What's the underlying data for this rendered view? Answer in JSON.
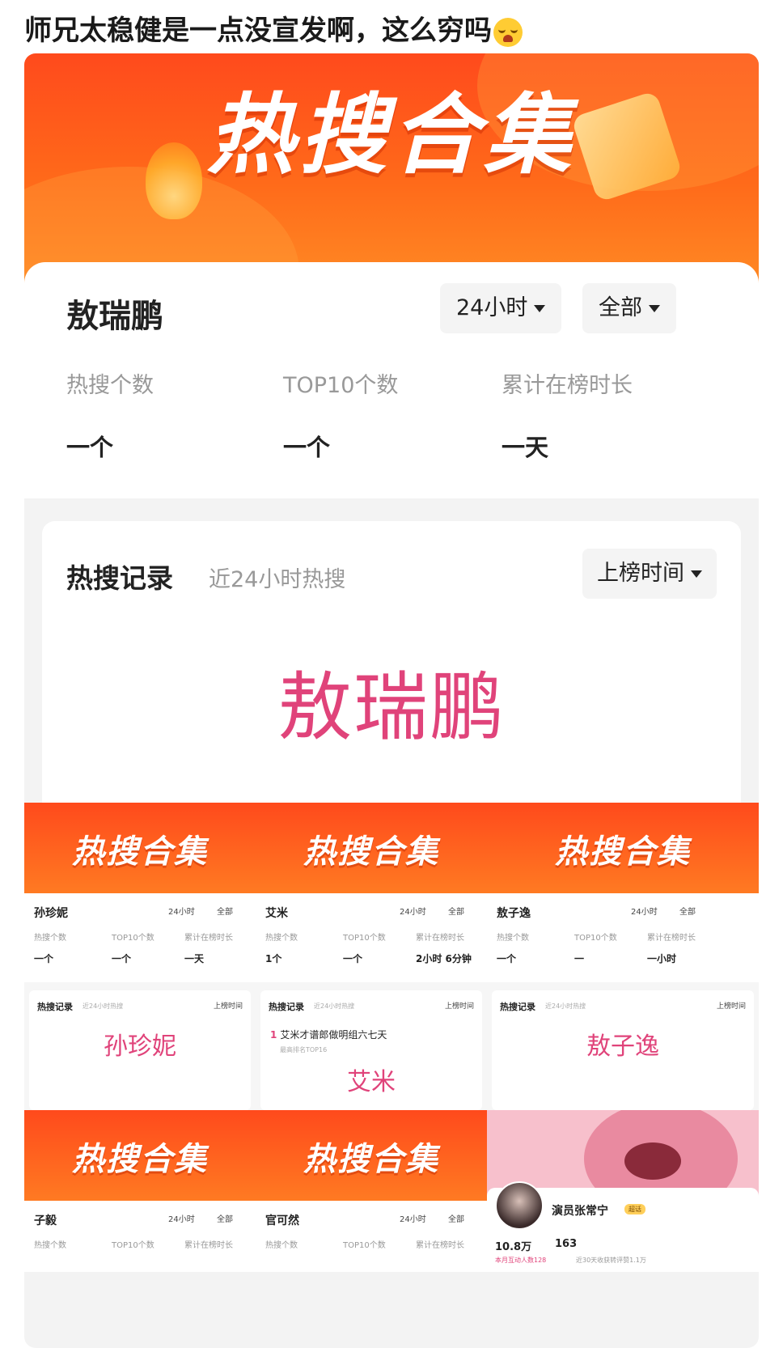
{
  "post": {
    "caption": "师兄太稳健是一点没宣发啊，这么穷吗",
    "emoji": "loudly-crying-face-icon"
  },
  "hero": {
    "banner_title": "热搜合集",
    "name": "敖瑞鹏",
    "filter_time": "24小时",
    "filter_scope": "全部",
    "stats": [
      {
        "label": "热搜个数",
        "value": "一个"
      },
      {
        "label": "TOP10个数",
        "value": "一个"
      },
      {
        "label": "累计在榜时长",
        "value": "一天"
      }
    ],
    "records": {
      "title": "热搜记录",
      "subtitle": "近24小时热搜",
      "sort": "上榜时间",
      "big_name": "敖瑞鹏"
    }
  },
  "minis": [
    {
      "name": "孙珍妮",
      "time": "24小时",
      "scope": "全部",
      "labels": [
        "热搜个数",
        "TOP10个数",
        "累计在榜时长"
      ],
      "values": [
        "一个",
        "一个",
        "一天"
      ],
      "rec_title": "热搜记录",
      "rec_sub": "近24小时热搜",
      "rec_sort": "上榜时间",
      "big_name": "孙珍妮"
    },
    {
      "name": "艾米",
      "time": "24小时",
      "scope": "全部",
      "labels": [
        "热搜个数",
        "TOP10个数",
        "累计在榜时长"
      ],
      "values": [
        "1个",
        "一个",
        "2小时 6分钟"
      ],
      "rec_title": "热搜记录",
      "rec_sub": "近24小时热搜",
      "rec_sort": "上榜时间",
      "entry_rank": "1",
      "entry_text": "艾米才谱郎做明组六七天",
      "entry_sub": "最高排名TOP16",
      "big_name": "艾米"
    },
    {
      "name": "敖子逸",
      "time": "24小时",
      "scope": "全部",
      "labels": [
        "热搜个数",
        "TOP10个数",
        "累计在榜时长"
      ],
      "values": [
        "一个",
        "一",
        "一小时"
      ],
      "rec_title": "热搜记录",
      "rec_sub": "近24小时热搜",
      "rec_sort": "上榜时间",
      "big_name": "敖子逸"
    }
  ],
  "minis_row2": [
    {
      "name": "子毅",
      "time": "24小时",
      "scope": "全部",
      "labels": [
        "热搜个数",
        "TOP10个数",
        "累计在榜时长"
      ]
    },
    {
      "name": "官可然",
      "time": "24小时",
      "scope": "全部",
      "labels": [
        "热搜个数",
        "TOP10个数",
        "累计在榜时长"
      ]
    }
  ],
  "profile": {
    "name": "演员张常宁",
    "badge": "超话",
    "fans": "10.8万",
    "count": "163",
    "footer_left": "本月互动人数128",
    "footer_right": "近30天收获转评赞1.1万"
  },
  "colors": {
    "accent_orange": "#ff5a1c",
    "name_pink": "#e0437a",
    "label_gray": "#999999"
  }
}
